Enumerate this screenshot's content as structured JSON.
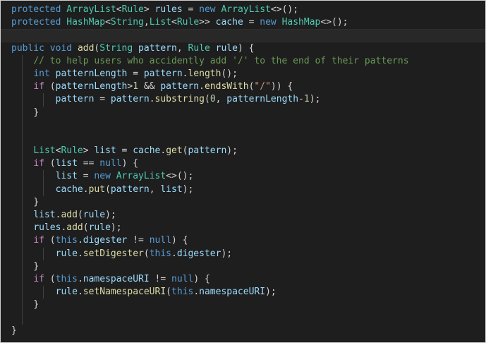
{
  "editor": {
    "theme": {
      "background": "#1e1e1e",
      "keyword": "#569cd6",
      "control": "#c586c0",
      "type": "#4ec9b0",
      "variable": "#9cdcfe",
      "function": "#dcdcaa",
      "string": "#ce9178",
      "number": "#b5cea8",
      "comment": "#6a9955",
      "plain": "#d4d4d4"
    },
    "lines": [
      {
        "indent": 0,
        "tokens": [
          {
            "t": "protected",
            "c": "keyword"
          },
          {
            "t": " ",
            "c": "plain"
          },
          {
            "t": "ArrayList",
            "c": "type"
          },
          {
            "t": "<",
            "c": "plain"
          },
          {
            "t": "Rule",
            "c": "type"
          },
          {
            "t": "> ",
            "c": "plain"
          },
          {
            "t": "rules",
            "c": "variable"
          },
          {
            "t": " = ",
            "c": "plain"
          },
          {
            "t": "new",
            "c": "keyword"
          },
          {
            "t": " ",
            "c": "plain"
          },
          {
            "t": "ArrayList",
            "c": "type"
          },
          {
            "t": "<>();",
            "c": "plain"
          }
        ]
      },
      {
        "indent": 0,
        "tokens": [
          {
            "t": "protected",
            "c": "keyword"
          },
          {
            "t": " ",
            "c": "plain"
          },
          {
            "t": "HashMap",
            "c": "type"
          },
          {
            "t": "<",
            "c": "plain"
          },
          {
            "t": "String",
            "c": "type"
          },
          {
            "t": ",",
            "c": "plain"
          },
          {
            "t": "List",
            "c": "type"
          },
          {
            "t": "<",
            "c": "plain"
          },
          {
            "t": "Rule",
            "c": "type"
          },
          {
            "t": ">> ",
            "c": "plain"
          },
          {
            "t": "cache",
            "c": "variable"
          },
          {
            "t": " = ",
            "c": "plain"
          },
          {
            "t": "new",
            "c": "keyword"
          },
          {
            "t": " ",
            "c": "plain"
          },
          {
            "t": "HashMap",
            "c": "type"
          },
          {
            "t": "<>();",
            "c": "plain"
          }
        ]
      },
      {
        "indent": 0,
        "current": true,
        "tokens": []
      },
      {
        "indent": 0,
        "tokens": [
          {
            "t": "public",
            "c": "keyword"
          },
          {
            "t": " ",
            "c": "plain"
          },
          {
            "t": "void",
            "c": "keyword"
          },
          {
            "t": " ",
            "c": "plain"
          },
          {
            "t": "add",
            "c": "function"
          },
          {
            "t": "(",
            "c": "plain"
          },
          {
            "t": "String",
            "c": "type"
          },
          {
            "t": " ",
            "c": "plain"
          },
          {
            "t": "pattern",
            "c": "variable"
          },
          {
            "t": ", ",
            "c": "plain"
          },
          {
            "t": "Rule",
            "c": "type"
          },
          {
            "t": " ",
            "c": "plain"
          },
          {
            "t": "rule",
            "c": "variable"
          },
          {
            "t": ") {",
            "c": "plain"
          }
        ]
      },
      {
        "indent": 1,
        "tokens": [
          {
            "t": "// to help users who accidently add '/' to the end of their patterns",
            "c": "comment"
          }
        ]
      },
      {
        "indent": 1,
        "tokens": [
          {
            "t": "int",
            "c": "keyword"
          },
          {
            "t": " ",
            "c": "plain"
          },
          {
            "t": "patternLength",
            "c": "variable"
          },
          {
            "t": " = ",
            "c": "plain"
          },
          {
            "t": "pattern",
            "c": "variable"
          },
          {
            "t": ".",
            "c": "plain"
          },
          {
            "t": "length",
            "c": "function"
          },
          {
            "t": "();",
            "c": "plain"
          }
        ]
      },
      {
        "indent": 1,
        "tokens": [
          {
            "t": "if",
            "c": "control"
          },
          {
            "t": " (",
            "c": "plain"
          },
          {
            "t": "patternLength",
            "c": "variable"
          },
          {
            "t": ">",
            "c": "plain"
          },
          {
            "t": "1",
            "c": "number"
          },
          {
            "t": " && ",
            "c": "plain"
          },
          {
            "t": "pattern",
            "c": "variable"
          },
          {
            "t": ".",
            "c": "plain"
          },
          {
            "t": "endsWith",
            "c": "function"
          },
          {
            "t": "(",
            "c": "plain"
          },
          {
            "t": "\"/\"",
            "c": "string"
          },
          {
            "t": ")) {",
            "c": "plain"
          }
        ]
      },
      {
        "indent": 2,
        "tokens": [
          {
            "t": "pattern",
            "c": "variable"
          },
          {
            "t": " = ",
            "c": "plain"
          },
          {
            "t": "pattern",
            "c": "variable"
          },
          {
            "t": ".",
            "c": "plain"
          },
          {
            "t": "substring",
            "c": "function"
          },
          {
            "t": "(",
            "c": "plain"
          },
          {
            "t": "0",
            "c": "number"
          },
          {
            "t": ", ",
            "c": "plain"
          },
          {
            "t": "patternLength",
            "c": "variable"
          },
          {
            "t": "-",
            "c": "plain"
          },
          {
            "t": "1",
            "c": "number"
          },
          {
            "t": ");",
            "c": "plain"
          }
        ]
      },
      {
        "indent": 1,
        "tokens": [
          {
            "t": "}",
            "c": "plain"
          }
        ]
      },
      {
        "indent": 1,
        "tokens": []
      },
      {
        "indent": 1,
        "tokens": []
      },
      {
        "indent": 1,
        "tokens": [
          {
            "t": "List",
            "c": "type"
          },
          {
            "t": "<",
            "c": "plain"
          },
          {
            "t": "Rule",
            "c": "type"
          },
          {
            "t": "> ",
            "c": "plain"
          },
          {
            "t": "list",
            "c": "variable"
          },
          {
            "t": " = ",
            "c": "plain"
          },
          {
            "t": "cache",
            "c": "variable"
          },
          {
            "t": ".",
            "c": "plain"
          },
          {
            "t": "get",
            "c": "function"
          },
          {
            "t": "(",
            "c": "plain"
          },
          {
            "t": "pattern",
            "c": "variable"
          },
          {
            "t": ");",
            "c": "plain"
          }
        ]
      },
      {
        "indent": 1,
        "tokens": [
          {
            "t": "if",
            "c": "control"
          },
          {
            "t": " (",
            "c": "plain"
          },
          {
            "t": "list",
            "c": "variable"
          },
          {
            "t": " == ",
            "c": "plain"
          },
          {
            "t": "null",
            "c": "keyword"
          },
          {
            "t": ") {",
            "c": "plain"
          }
        ]
      },
      {
        "indent": 2,
        "tokens": [
          {
            "t": "list",
            "c": "variable"
          },
          {
            "t": " = ",
            "c": "plain"
          },
          {
            "t": "new",
            "c": "keyword"
          },
          {
            "t": " ",
            "c": "plain"
          },
          {
            "t": "ArrayList",
            "c": "type"
          },
          {
            "t": "<>();",
            "c": "plain"
          }
        ]
      },
      {
        "indent": 2,
        "tokens": [
          {
            "t": "cache",
            "c": "variable"
          },
          {
            "t": ".",
            "c": "plain"
          },
          {
            "t": "put",
            "c": "function"
          },
          {
            "t": "(",
            "c": "plain"
          },
          {
            "t": "pattern",
            "c": "variable"
          },
          {
            "t": ", ",
            "c": "plain"
          },
          {
            "t": "list",
            "c": "variable"
          },
          {
            "t": ");",
            "c": "plain"
          }
        ]
      },
      {
        "indent": 1,
        "tokens": [
          {
            "t": "}",
            "c": "plain"
          }
        ]
      },
      {
        "indent": 1,
        "tokens": [
          {
            "t": "list",
            "c": "variable"
          },
          {
            "t": ".",
            "c": "plain"
          },
          {
            "t": "add",
            "c": "function"
          },
          {
            "t": "(",
            "c": "plain"
          },
          {
            "t": "rule",
            "c": "variable"
          },
          {
            "t": ");",
            "c": "plain"
          }
        ]
      },
      {
        "indent": 1,
        "tokens": [
          {
            "t": "rules",
            "c": "variable"
          },
          {
            "t": ".",
            "c": "plain"
          },
          {
            "t": "add",
            "c": "function"
          },
          {
            "t": "(",
            "c": "plain"
          },
          {
            "t": "rule",
            "c": "variable"
          },
          {
            "t": ");",
            "c": "plain"
          }
        ]
      },
      {
        "indent": 1,
        "tokens": [
          {
            "t": "if",
            "c": "control"
          },
          {
            "t": " (",
            "c": "plain"
          },
          {
            "t": "this",
            "c": "keyword"
          },
          {
            "t": ".",
            "c": "plain"
          },
          {
            "t": "digester",
            "c": "variable"
          },
          {
            "t": " != ",
            "c": "plain"
          },
          {
            "t": "null",
            "c": "keyword"
          },
          {
            "t": ") {",
            "c": "plain"
          }
        ]
      },
      {
        "indent": 2,
        "tokens": [
          {
            "t": "rule",
            "c": "variable"
          },
          {
            "t": ".",
            "c": "plain"
          },
          {
            "t": "setDigester",
            "c": "function"
          },
          {
            "t": "(",
            "c": "plain"
          },
          {
            "t": "this",
            "c": "keyword"
          },
          {
            "t": ".",
            "c": "plain"
          },
          {
            "t": "digester",
            "c": "variable"
          },
          {
            "t": ");",
            "c": "plain"
          }
        ]
      },
      {
        "indent": 1,
        "tokens": [
          {
            "t": "}",
            "c": "plain"
          }
        ]
      },
      {
        "indent": 1,
        "tokens": [
          {
            "t": "if",
            "c": "control"
          },
          {
            "t": " (",
            "c": "plain"
          },
          {
            "t": "this",
            "c": "keyword"
          },
          {
            "t": ".",
            "c": "plain"
          },
          {
            "t": "namespaceURI",
            "c": "variable"
          },
          {
            "t": " != ",
            "c": "plain"
          },
          {
            "t": "null",
            "c": "keyword"
          },
          {
            "t": ") {",
            "c": "plain"
          }
        ]
      },
      {
        "indent": 2,
        "tokens": [
          {
            "t": "rule",
            "c": "variable"
          },
          {
            "t": ".",
            "c": "plain"
          },
          {
            "t": "setNamespaceURI",
            "c": "function"
          },
          {
            "t": "(",
            "c": "plain"
          },
          {
            "t": "this",
            "c": "keyword"
          },
          {
            "t": ".",
            "c": "plain"
          },
          {
            "t": "namespaceURI",
            "c": "variable"
          },
          {
            "t": ");",
            "c": "plain"
          }
        ]
      },
      {
        "indent": 1,
        "tokens": [
          {
            "t": "}",
            "c": "plain"
          }
        ]
      },
      {
        "indent": 1,
        "tokens": []
      },
      {
        "indent": 0,
        "tokens": [
          {
            "t": "}",
            "c": "plain"
          }
        ]
      }
    ]
  }
}
